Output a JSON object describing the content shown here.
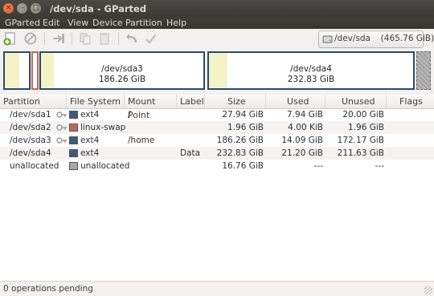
{
  "window": {
    "title": "/dev/sda - GParted"
  },
  "menu": [
    "GParted",
    "Edit",
    "View",
    "Device",
    "Partition",
    "Help"
  ],
  "device_selector": {
    "label": "/dev/sda",
    "size": "(465.76 GiB)"
  },
  "partition_map": {
    "sda3": {
      "name": "/dev/sda3",
      "size": "186.26 GiB",
      "used_fraction": 0.08
    },
    "sda4": {
      "name": "/dev/sda4",
      "size": "232.83 GiB",
      "used_fraction": 0.09
    }
  },
  "table": {
    "columns": [
      "Partition",
      "File System",
      "Mount Point",
      "Label",
      "Size",
      "Used",
      "Unused",
      "Flags"
    ],
    "rows": [
      {
        "partition": "/dev/sda1",
        "filesystem": "ext4",
        "fs_color": "#3d5a80",
        "mount": "/",
        "label": "",
        "size": "27.94 GiB",
        "used": "7.94 GiB",
        "unused": "20.00 GiB",
        "flags": "",
        "key": true
      },
      {
        "partition": "/dev/sda2",
        "filesystem": "linux-swap",
        "fs_color": "#c1665a",
        "mount": "",
        "label": "",
        "size": "1.96 GiB",
        "used": "4.00 KiB",
        "unused": "1.96 GiB",
        "flags": "",
        "key": true
      },
      {
        "partition": "/dev/sda3",
        "filesystem": "ext4",
        "fs_color": "#3d5a80",
        "mount": "/home",
        "label": "",
        "size": "186.26 GiB",
        "used": "14.09 GiB",
        "unused": "172.17 GiB",
        "flags": "",
        "key": true
      },
      {
        "partition": "/dev/sda4",
        "filesystem": "ext4",
        "fs_color": "#3d5a80",
        "mount": "",
        "label": "Data",
        "size": "232.83 GiB",
        "used": "21.20 GiB",
        "unused": "211.63 GiB",
        "flags": "",
        "key": false
      },
      {
        "partition": "unallocated",
        "filesystem": "unallocated",
        "fs_color": "#a8a8a8",
        "mount": "",
        "label": "",
        "size": "16.76 GiB",
        "used": "---",
        "unused": "---",
        "flags": "",
        "key": false
      }
    ]
  },
  "statusbar": {
    "text": "0 operations pending"
  },
  "icons": {
    "close": "close-icon",
    "minimize": "minimize-icon",
    "maximize": "maximize-icon",
    "new": "new-partition-icon",
    "delete": "delete-icon",
    "resize": "resize-move-icon",
    "copy": "copy-icon",
    "paste": "paste-icon",
    "undo": "undo-icon",
    "apply": "apply-icon",
    "disk": "hard-disk-icon",
    "key": "key-icon"
  }
}
